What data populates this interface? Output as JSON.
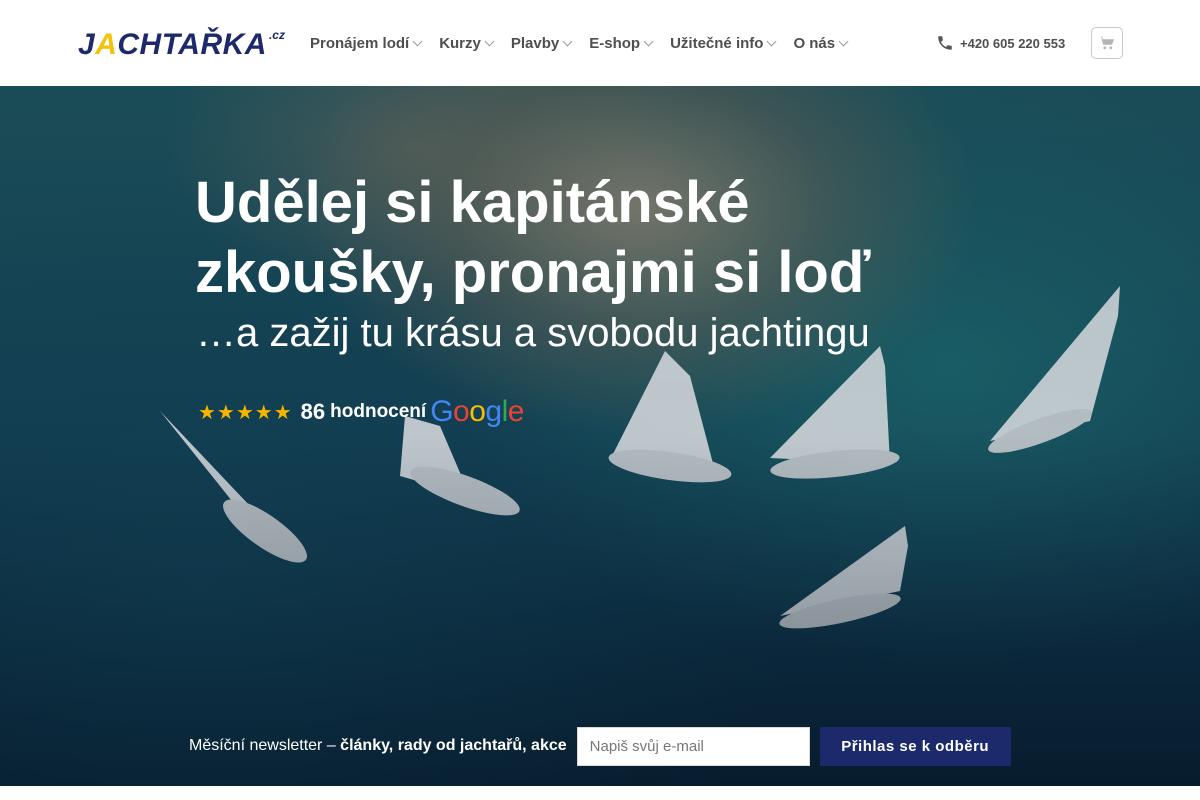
{
  "logo": {
    "main": "JACHTAŘKA",
    "first_letter": "J",
    "accent_letter": "A",
    "rest": "CHTAŘKA",
    "tld": ".cz"
  },
  "nav": {
    "items": [
      {
        "label": "Pronájem lodí"
      },
      {
        "label": "Kurzy"
      },
      {
        "label": "Plavby"
      },
      {
        "label": "E-shop"
      },
      {
        "label": "Užitečné info"
      },
      {
        "label": "O nás"
      }
    ]
  },
  "header": {
    "phone": "+420 605 220 553",
    "phone_icon": "phone-icon",
    "cart_icon": "cart-icon"
  },
  "hero": {
    "title": "Udělej si kapitánské zkoušky, pronajmi si loď",
    "subtitle": "…a zažij tu krásu a svobodu jachtingu",
    "rating": {
      "stars": "★★★★★",
      "count": "86",
      "label": "hodnocení",
      "provider_letters": [
        "G",
        "o",
        "o",
        "g",
        "l",
        "e"
      ]
    }
  },
  "newsletter": {
    "prefix": "Měsíční newsletter – ",
    "highlight": "články, rady od jachtařů, akce",
    "input_placeholder": "Napiš svůj e-mail",
    "button_label": "Přihlas se k odběru"
  },
  "colors": {
    "brand": "#1c2a6b",
    "accent": "#f4c20d",
    "nav_text": "#4f4f4f",
    "star": "#f6b400"
  }
}
